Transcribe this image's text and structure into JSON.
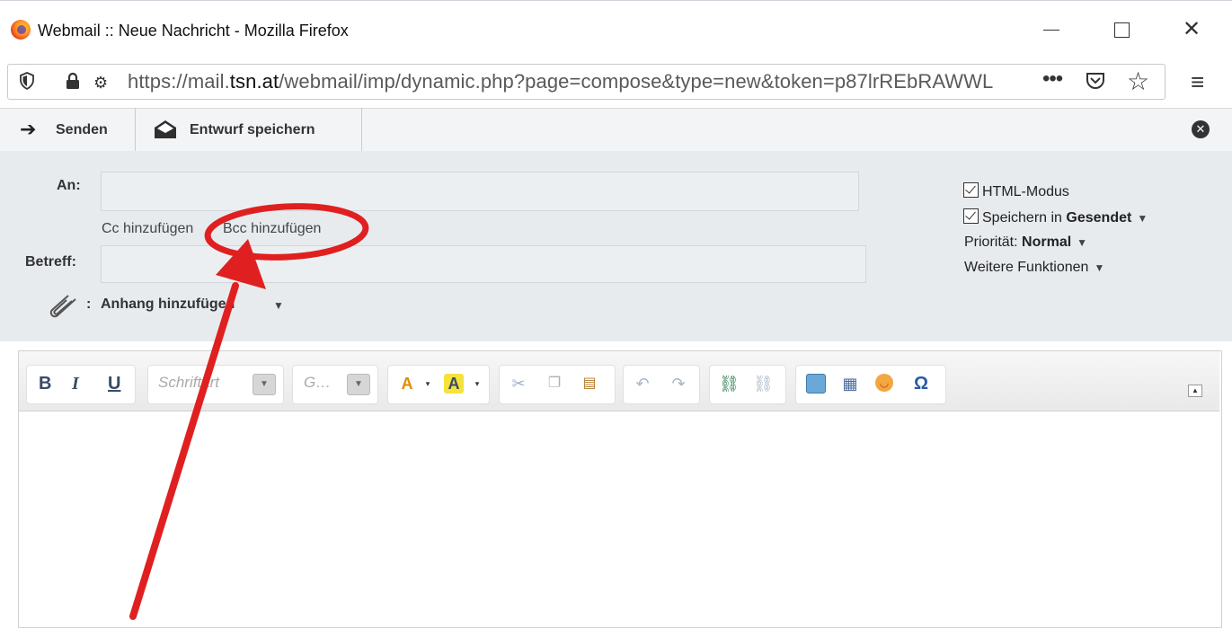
{
  "window": {
    "title": "Webmail :: Neue Nachricht - Mozilla Firefox",
    "minimize": "—",
    "maximize": "□",
    "close": "✕"
  },
  "urlbar": {
    "prefix": "https://mail.",
    "domain": "tsn.at",
    "path": "/webmail/imp/dynamic.php?page=compose&type=new&token=p87lrREbRAWWL",
    "more": "•••",
    "star": "☆",
    "menu": "≡"
  },
  "toolbar": {
    "send_label": "Senden",
    "draft_label": "Entwurf speichern",
    "close_label": "✕"
  },
  "headers": {
    "to_label": "An:",
    "to_value": "",
    "cc_link": "Cc hinzufügen",
    "bcc_link": "Bcc hinzufügen",
    "subject_label": "Betreff:",
    "subject_value": "",
    "attach_colon": ":",
    "attach_link": "Anhang hinzufügen"
  },
  "options": {
    "html_mode": "HTML-Modus",
    "save_in": "Speichern in",
    "save_folder": "Gesendet",
    "priority_label": "Priorität:",
    "priority_value": "Normal",
    "more_functions": "Weitere Funktionen"
  },
  "editor": {
    "bold": "B",
    "italic": "I",
    "underline": "U",
    "font_placeholder": "Schriftart",
    "size_placeholder": "G…"
  },
  "colors": {
    "accent_red": "#e02020",
    "header_bg": "#e8ebee"
  }
}
